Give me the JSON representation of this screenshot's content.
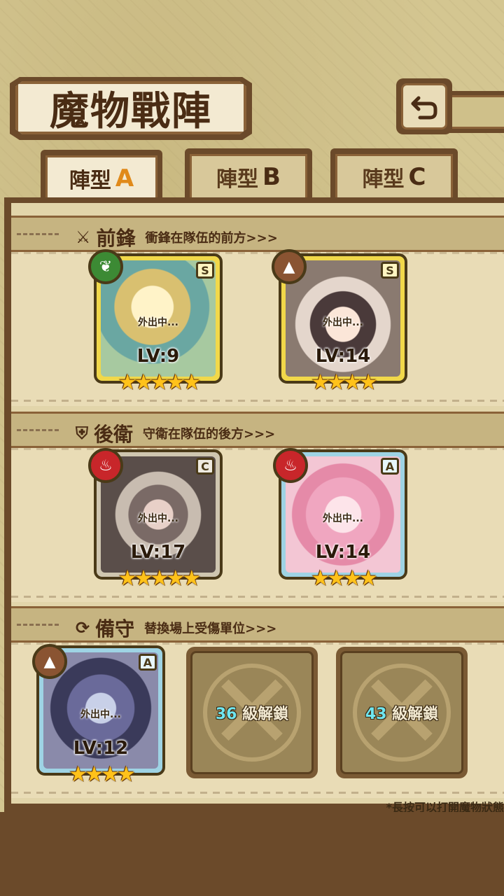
{
  "title": "魔物戰陣",
  "back_icon": "back-arrow-icon",
  "tabs": [
    {
      "label": "陣型",
      "letter": "A",
      "active": true
    },
    {
      "label": "陣型",
      "letter": "B",
      "active": false
    },
    {
      "label": "陣型",
      "letter": "C",
      "active": false
    }
  ],
  "sections": {
    "front": {
      "icon": "sword-icon",
      "title": "前鋒",
      "desc": "衝鋒在隊伍的前方>>>"
    },
    "back": {
      "icon": "shield-icon",
      "title": "後衛",
      "desc": "守衛在隊伍的後方>>>"
    },
    "reserve": {
      "icon": "swap-icon",
      "title": "備守",
      "desc": "替換場上受傷單位>>>"
    }
  },
  "cards": {
    "front1": {
      "rank": "S",
      "element": "leaf",
      "status": "外出中...",
      "level": "LV:9",
      "stars": "★★★★★"
    },
    "front2": {
      "rank": "S",
      "element": "earth",
      "status": "外出中...",
      "level": "LV:14",
      "stars": "★★★★"
    },
    "back1": {
      "rank": "C",
      "element": "fire",
      "status": "外出中...",
      "level": "LV:17",
      "stars": "★★★★★"
    },
    "back2": {
      "rank": "A",
      "element": "fire",
      "status": "外出中...",
      "level": "LV:14",
      "stars": "★★★★"
    },
    "reserve1": {
      "rank": "A",
      "element": "earth",
      "status": "外出中...",
      "level": "LV:12",
      "stars": "★★★★"
    }
  },
  "locks": [
    {
      "level": "36",
      "text": "級解鎖"
    },
    {
      "level": "43",
      "text": "級解鎖"
    }
  ],
  "footnote": "*長按可以打開魔物狀態",
  "colors": {
    "frame": "#6b4a2a",
    "gold": "#f1d84a",
    "silver": "#9ed3e4",
    "active_letter": "#e08a1a",
    "lock_num": "#6fe6f0"
  }
}
